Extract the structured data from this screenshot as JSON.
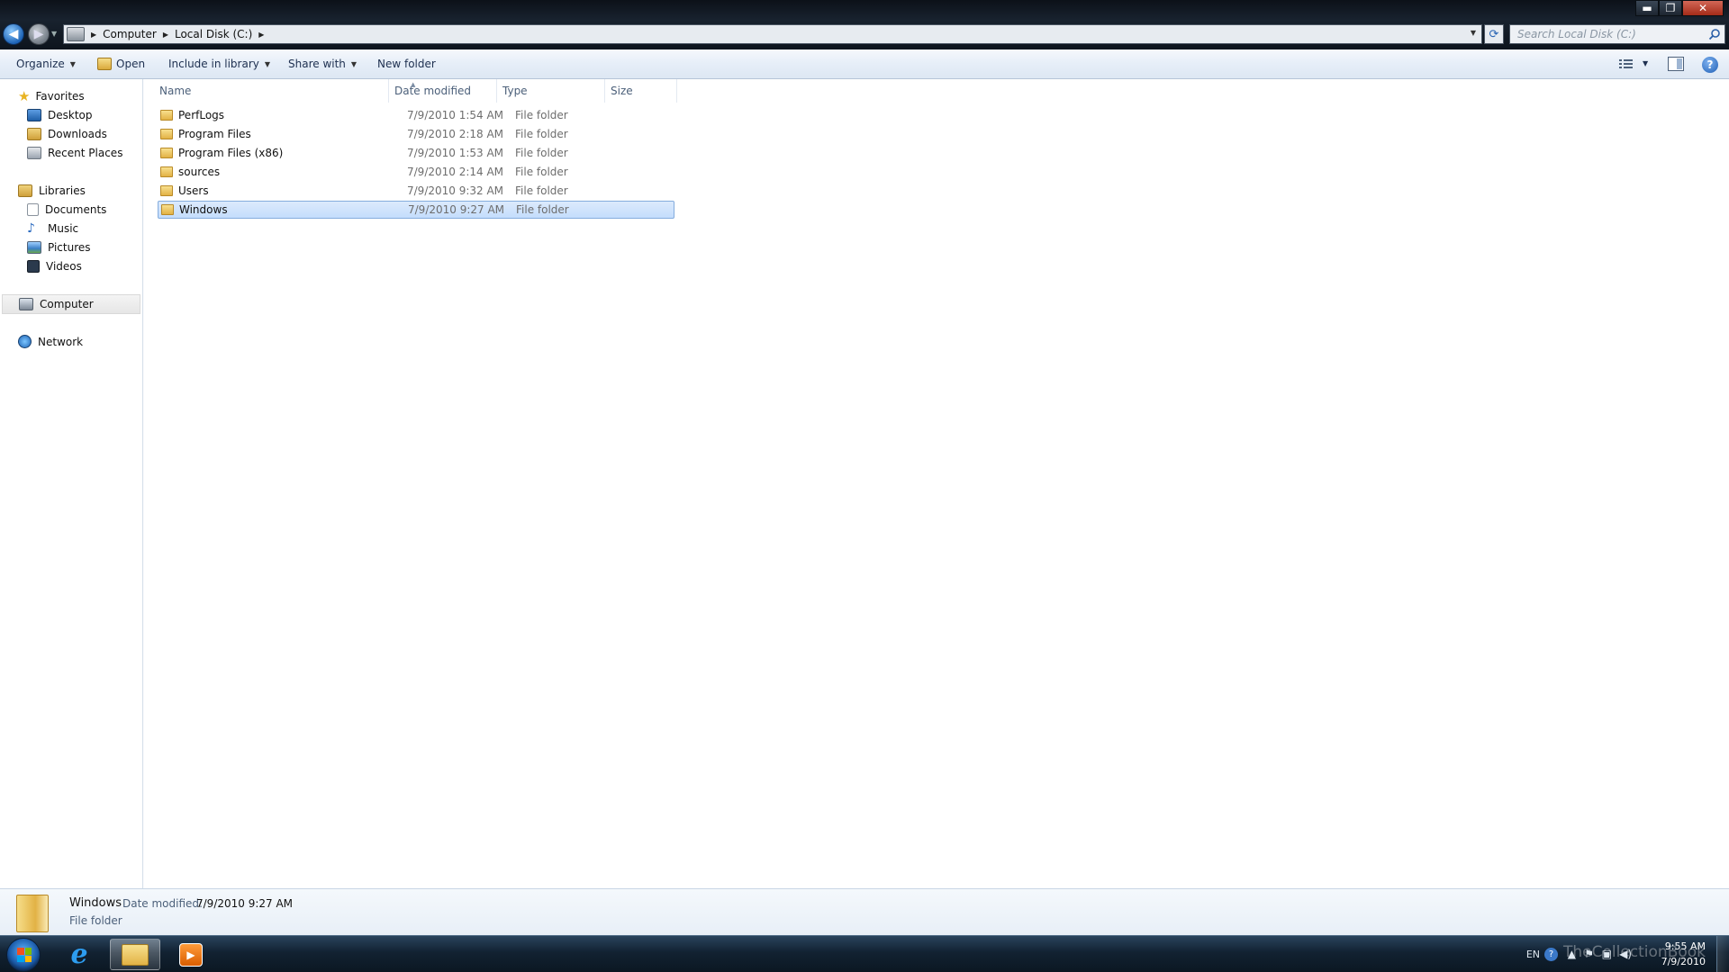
{
  "window": {
    "controls": {
      "minimize": "▬",
      "maximize": "❐",
      "close": "✕"
    }
  },
  "address": {
    "crumbs": [
      "Computer",
      "Local Disk (C:)"
    ],
    "search_placeholder": "Search Local Disk (C:)"
  },
  "toolbar": {
    "organize": "Organize",
    "open": "Open",
    "include_in_library": "Include in library",
    "share_with": "Share with",
    "new_folder": "New folder",
    "help": "?"
  },
  "sidebar": {
    "favorites": "Favorites",
    "favorites_items": [
      "Desktop",
      "Downloads",
      "Recent Places"
    ],
    "libraries": "Libraries",
    "libraries_items": [
      "Documents",
      "Music",
      "Pictures",
      "Videos"
    ],
    "computer": "Computer",
    "network": "Network"
  },
  "columns": {
    "name": "Name",
    "date_modified": "Date modified",
    "type": "Type",
    "size": "Size"
  },
  "files": [
    {
      "name": "PerfLogs",
      "date": "7/9/2010 1:54 AM",
      "type": "File folder"
    },
    {
      "name": "Program Files",
      "date": "7/9/2010 2:18 AM",
      "type": "File folder"
    },
    {
      "name": "Program Files (x86)",
      "date": "7/9/2010 1:53 AM",
      "type": "File folder"
    },
    {
      "name": "sources",
      "date": "7/9/2010 2:14 AM",
      "type": "File folder"
    },
    {
      "name": "Users",
      "date": "7/9/2010 9:32 AM",
      "type": "File folder"
    },
    {
      "name": "Windows",
      "date": "7/9/2010 9:27 AM",
      "type": "File folder",
      "selected": true
    }
  ],
  "details": {
    "name": "Windows",
    "date_label": "Date modified:",
    "date_value": "7/9/2010 9:27 AM",
    "type": "File folder"
  },
  "taskbar": {
    "ie_glyph": "e",
    "tray_lang": "EN",
    "tray_help": "?",
    "clock_time": "9:55 AM",
    "clock_date": "7/9/2010",
    "watermark": "TheCollectionBook"
  },
  "colors": {
    "selection": "#cce0fc",
    "selection_border": "#84acdd",
    "link_text": "#1e3050"
  }
}
